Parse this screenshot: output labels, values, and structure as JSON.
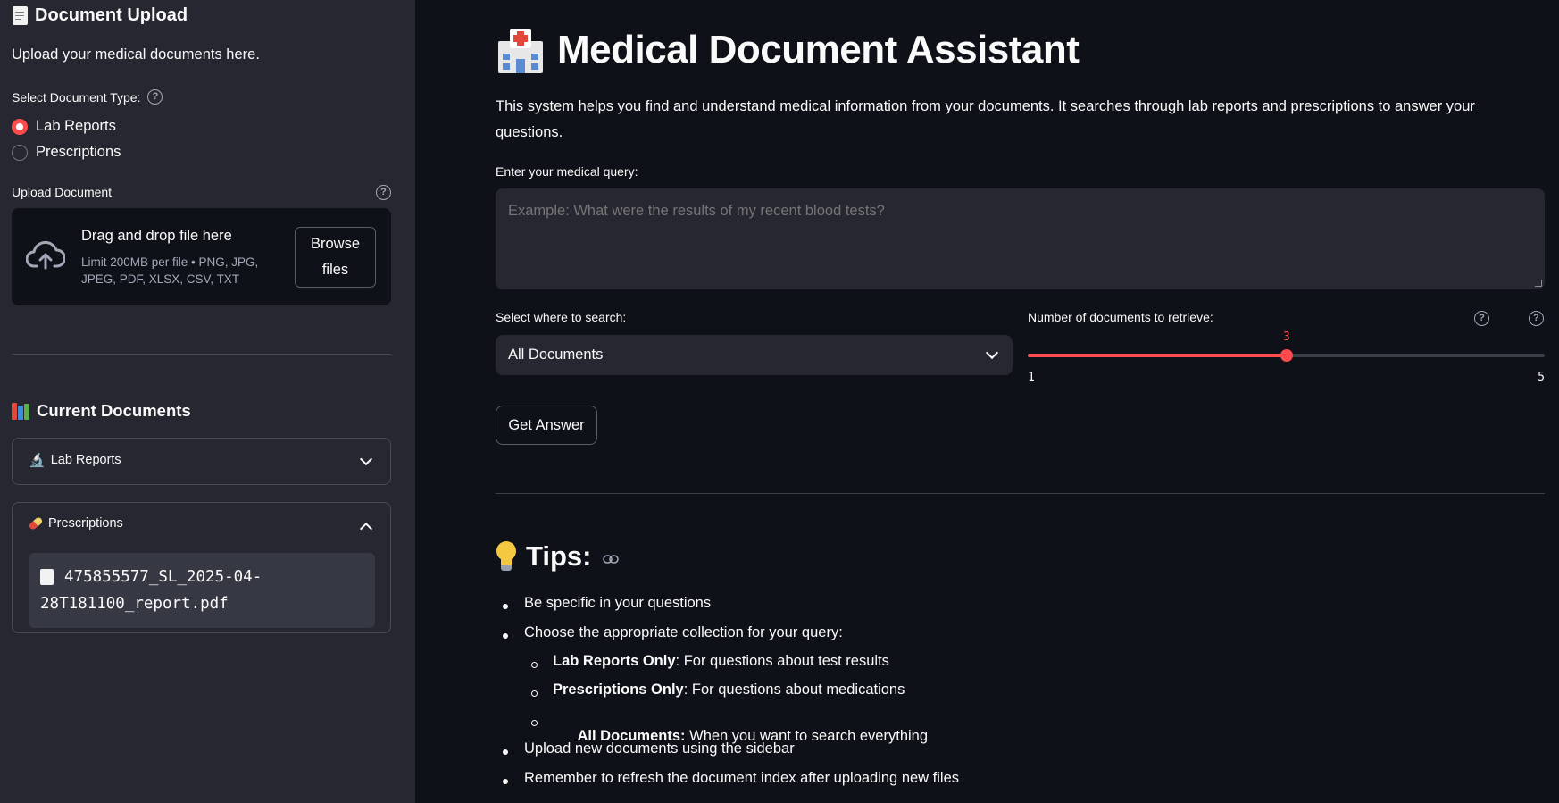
{
  "sidebar": {
    "upload_title": "Document Upload",
    "upload_icon": "page-icon",
    "upload_subtitle": "Upload your medical documents here.",
    "doc_type_label": "Select Document Type:",
    "doc_type_options": [
      "Lab Reports",
      "Prescriptions"
    ],
    "doc_type_selected": "Lab Reports",
    "upload_label": "Upload Document",
    "dropzone": {
      "title": "Drag and drop file here",
      "limit_line1": "Limit 200MB per file • PNG, JPG,",
      "limit_line2": "JPEG, PDF, XLSX, CSV, TXT",
      "browse_line1": "Browse",
      "browse_line2": "files"
    },
    "current_docs_title": "Current Documents",
    "current_docs_icon": "books-icon",
    "expanders": [
      {
        "label": "Lab Reports",
        "icon": "microscope-icon",
        "expanded": false
      },
      {
        "label": "Prescriptions",
        "icon": "pill-icon",
        "expanded": true,
        "file_line1": "475855577_SL_2025-04-",
        "file_line2": "28T181100_report.pdf"
      }
    ]
  },
  "main": {
    "title": "Medical Document Assistant",
    "title_icon": "hospital-icon",
    "description_line1": "This system helps you find and understand medical information from your documents. It searches through lab reports and prescriptions to answer your",
    "description_line2": "questions.",
    "query_label": "Enter your medical query:",
    "query_placeholder": "Example: What were the results of my recent blood tests?",
    "query_value": "",
    "search_label": "Select where to search:",
    "search_selected": "All Documents",
    "slider_label": "Number of documents to retrieve:",
    "slider": {
      "min": 1,
      "max": 5,
      "value": 3,
      "min_label": "1",
      "max_label": "5",
      "value_label": "3"
    },
    "submit_label": "Get Answer",
    "tips": {
      "title": "Tips:",
      "icon": "lightbulb-icon",
      "items": [
        {
          "text": "Be specific in your questions"
        },
        {
          "text": "Choose the appropriate collection for your query:"
        },
        {
          "bold": "Lab Reports Only",
          "text": ": For questions about test results"
        },
        {
          "bold": "Prescriptions Only",
          "text": ": For questions about medications"
        },
        {
          "bold": "All Documents:",
          "text": " When you want to search everything"
        },
        {
          "text": "Upload new documents using the sidebar"
        },
        {
          "text": "Remember to refresh the document index after uploading new files"
        }
      ]
    }
  },
  "colors": {
    "accent": "#ff4b4b",
    "sidebar_bg": "#262730",
    "main_bg": "#0e1117",
    "input_bg": "#262730"
  }
}
